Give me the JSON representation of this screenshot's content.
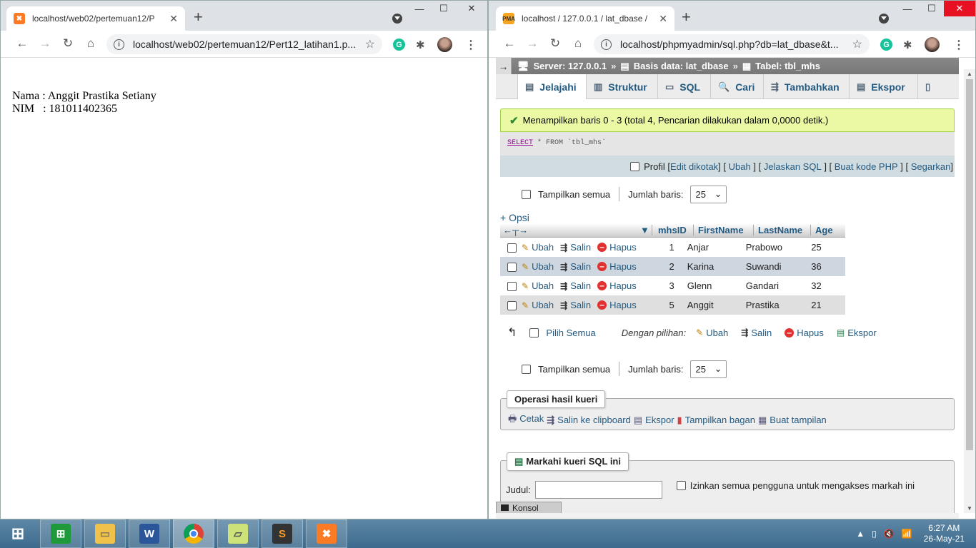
{
  "left_window": {
    "tab_title": "localhost/web02/pertemuan12/P",
    "url": "localhost/web02/pertemuan12/Pert12_latihan1.p...",
    "content": {
      "line1": "Nama : Anggit Prastika Setiany",
      "line2": "NIM   : 181011402365"
    }
  },
  "right_window": {
    "tab_title": "localhost / 127.0.0.1 / lat_dbase /",
    "url": "localhost/phpmyadmin/sql.php?db=lat_dbase&t...",
    "breadcrumb": {
      "server": "Server: 127.0.0.1",
      "database": "Basis data: lat_dbase",
      "table": "Tabel: tbl_mhs"
    },
    "tabs": [
      "Jelajahi",
      "Struktur",
      "SQL",
      "Cari",
      "Tambahkan",
      "Ekspor"
    ],
    "success_message": "Menampilkan baris 0 - 3 (total 4, Pencarian dilakukan dalam 0,0000 detik.)",
    "sql": {
      "keyword": "SELECT",
      "rest": "* FROM `tbl_mhs`"
    },
    "sql_tools": {
      "profil": "Profil",
      "links": [
        "Edit dikotak",
        "Ubah",
        "Jelaskan SQL",
        "Buat kode PHP",
        "Segarkan"
      ]
    },
    "nav": {
      "show_all": "Tampilkan semua",
      "rows_label": "Jumlah baris:",
      "rows_value": "25"
    },
    "options_link": "+ Opsi",
    "columns": [
      "mhsID",
      "FirstName",
      "LastName",
      "Age"
    ],
    "row_actions": {
      "edit": "Ubah",
      "copy": "Salin",
      "delete": "Hapus"
    },
    "rows": [
      {
        "id": "1",
        "first": "Anjar",
        "last": "Prabowo",
        "age": "25"
      },
      {
        "id": "2",
        "first": "Karina",
        "last": "Suwandi",
        "age": "36"
      },
      {
        "id": "3",
        "first": "Glenn",
        "last": "Gandari",
        "age": "32"
      },
      {
        "id": "5",
        "first": "Anggit",
        "last": "Prastika",
        "age": "21"
      }
    ],
    "bulk": {
      "select_all": "Pilih Semua",
      "with_selected": "Dengan pilihan:",
      "edit": "Ubah",
      "copy": "Salin",
      "delete": "Hapus",
      "export": "Ekspor"
    },
    "query_ops": {
      "legend": "Operasi hasil kueri",
      "print": "Cetak",
      "copy_clipboard": "Salin ke clipboard",
      "export": "Ekspor",
      "chart": "Tampilkan bagan",
      "create_view": "Buat tampilan"
    },
    "bookmark": {
      "legend": "Markahi kueri SQL ini",
      "title_label": "Judul:",
      "allow_all": "Izinkan semua pengguna untuk mengakses markah ini"
    },
    "console": "Konsol"
  },
  "taskbar": {
    "time": "6:27 AM",
    "date": "26-May-21"
  },
  "colors": {
    "link": "#235a81",
    "success_bg": "#ebf8a4",
    "close_red": "#e81123"
  }
}
